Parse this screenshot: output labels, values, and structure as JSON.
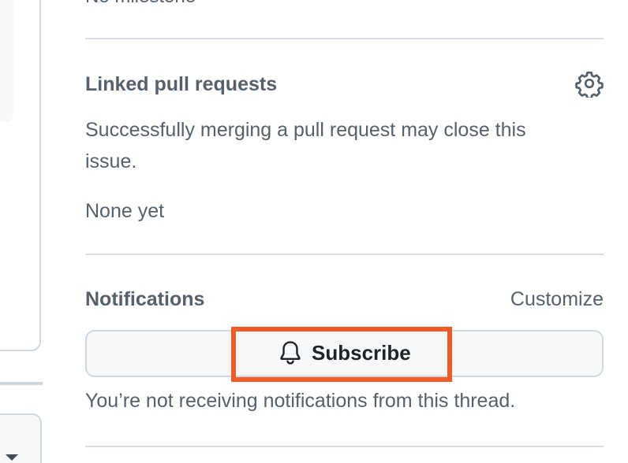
{
  "sidebar": {
    "milestone": {
      "value": "No milestone"
    },
    "linked_pull_requests": {
      "heading": "Linked pull requests",
      "description": "Successfully merging a pull request may close this issue.",
      "description_line1": "Successfully merging a pull request may close this",
      "description_line2": "issue.",
      "status": "None yet",
      "settings_icon": "gear-icon"
    },
    "notifications": {
      "heading": "Notifications",
      "customize_label": "Customize",
      "subscribe_label": "Subscribe",
      "subscribe_icon": "bell-icon",
      "status_text": "You’re not receiving notifications from this thread."
    }
  },
  "annotation": {
    "highlight_color": "#ef5b25",
    "highlight_target": "subscribe-button"
  }
}
